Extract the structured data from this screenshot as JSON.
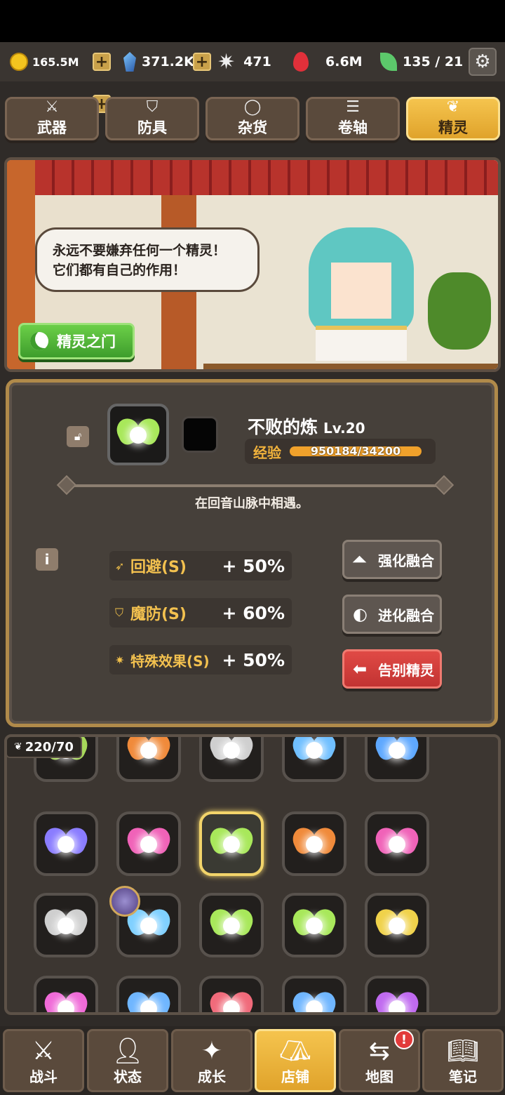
{
  "resources": {
    "gold": "165.5M",
    "gems": "371.2K",
    "stars": "471",
    "fire": "6.6M",
    "energy": "135 / 21"
  },
  "tabs": [
    {
      "label": "武器",
      "icon": "sword-icon"
    },
    {
      "label": "防具",
      "icon": "shield-icon"
    },
    {
      "label": "杂货",
      "icon": "ring-icon"
    },
    {
      "label": "卷轴",
      "icon": "scroll-icon"
    },
    {
      "label": "精灵",
      "icon": "wings-icon",
      "active": true
    }
  ],
  "scene": {
    "speech": "永远不要嫌弃任何一个精灵！\n它们都有自己的作用！",
    "gate_button": "精灵之门"
  },
  "spirit": {
    "name": "不败的炼",
    "level": "Lv.20",
    "exp_label": "经验",
    "exp_text": "950184/34200",
    "exp_fill": 1.0,
    "description": "在回音山脉中相遇。",
    "stats": [
      {
        "name": "回避(S)",
        "value": "+ 50%",
        "icon": "dodge-icon"
      },
      {
        "name": "魔防(S)",
        "value": "+ 60%",
        "icon": "magic-defense-icon"
      },
      {
        "name": "特殊效果(S)",
        "value": "+ 50%",
        "icon": "special-effect-icon"
      }
    ],
    "actions": {
      "enhance": "强化融合",
      "evolve": "进化融合",
      "farewell": "告别精灵"
    }
  },
  "inventory": {
    "count": "220/70",
    "colors": [
      "#a7d85a",
      "#f08a3a",
      "#cfcfcf",
      "#6fbfff",
      "#5ea8ff",
      "#8a7cff",
      "#f062b8",
      "#a8e85a",
      "#f08a3a",
      "#f062b8",
      "#cfcfcf",
      "#7fd0ff",
      "#a8e85a",
      "#a8e85a",
      "#f0d24a",
      "#f06ad8",
      "#6fb6ff",
      "#f06a7a",
      "#6fb6ff",
      "#c06af0"
    ]
  },
  "nav": [
    {
      "label": "战斗",
      "icon": "battle-icon"
    },
    {
      "label": "状态",
      "icon": "person-icon"
    },
    {
      "label": "成长",
      "icon": "sparkle-icon"
    },
    {
      "label": "店铺",
      "icon": "tent-icon",
      "active": true
    },
    {
      "label": "地图",
      "icon": "signpost-icon",
      "alert": "!"
    },
    {
      "label": "笔记",
      "icon": "book-icon"
    }
  ]
}
